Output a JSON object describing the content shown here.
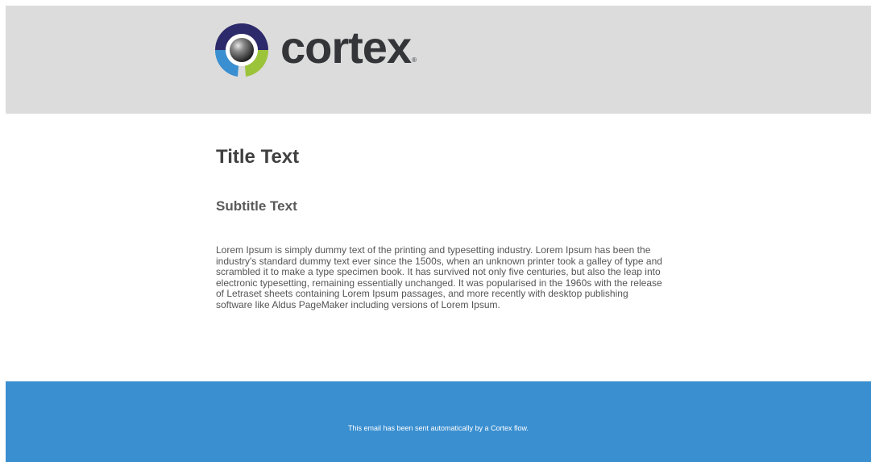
{
  "header": {
    "brand": "cortex",
    "registered_mark": "®"
  },
  "content": {
    "title": "Title Text",
    "subtitle": "Subtitle Text",
    "body": "Lorem Ipsum is simply dummy text of the printing and typesetting industry. Lorem Ipsum has been the industry's standard dummy text ever since the 1500s, when an unknown printer took a galley of type and scrambled it to make a type specimen book. It has survived not only five centuries, but also the leap into electronic typesetting, remaining essentially unchanged. It was popularised in the 1960s with the release of Letraset sheets containing Lorem Ipsum passages, and more recently with desktop publishing software like Aldus PageMaker including versions of Lorem Ipsum."
  },
  "footer": {
    "note": "This email has been sent automatically by a Cortex flow."
  },
  "colors": {
    "header_bg": "#dcdcdc",
    "footer_bg": "#3a8fd0",
    "logo_navy": "#2d2a6b",
    "logo_blue": "#3a8fd0",
    "logo_green": "#9cc43a",
    "text_dark": "#404040"
  },
  "icons": {
    "logo_mark": "cortex-logo-icon"
  }
}
